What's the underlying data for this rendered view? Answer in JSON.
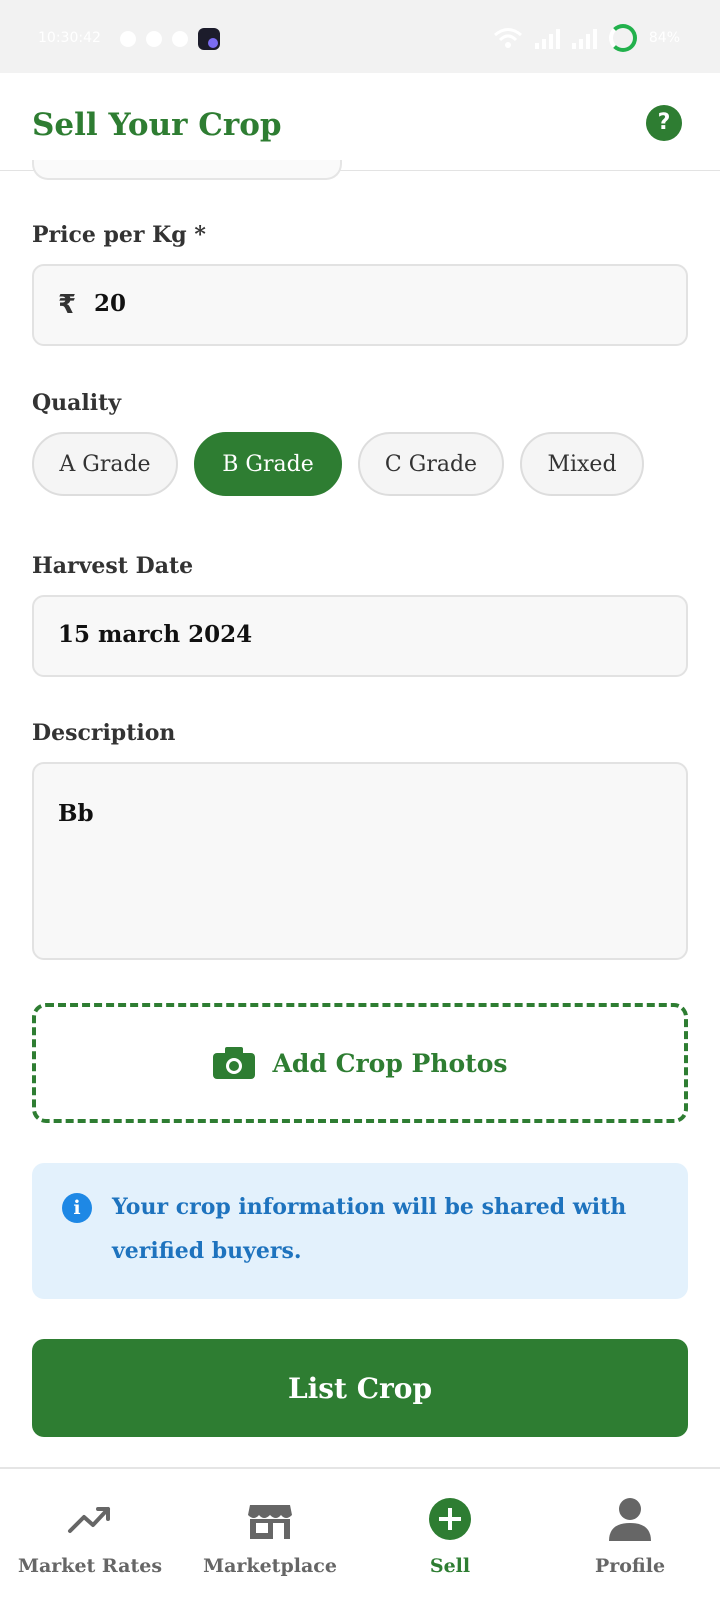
{
  "status_bar": {
    "time": "10:30:42",
    "battery": "84%"
  },
  "header": {
    "title": "Sell Your Crop",
    "help_icon": "question-circle-icon",
    "help_glyph": "?"
  },
  "form": {
    "price": {
      "label": "Price per Kg *",
      "currency_symbol": "₹",
      "value": "20"
    },
    "quality": {
      "label": "Quality",
      "options": [
        "A Grade",
        "B Grade",
        "C Grade",
        "Mixed"
      ],
      "selected": "B Grade"
    },
    "harvest_date": {
      "label": "Harvest Date",
      "value": "15 march 2024"
    },
    "description": {
      "label": "Description",
      "value": "Bb"
    },
    "photos": {
      "label": "Add Crop Photos",
      "icon": "camera-icon"
    },
    "info": {
      "icon": "info-icon",
      "glyph": "i",
      "text": "Your crop information will be shared with verified buyers."
    },
    "submit_label": "List Crop"
  },
  "bottom_nav": {
    "items": [
      {
        "label": "Market Rates",
        "icon": "trending-up-icon"
      },
      {
        "label": "Marketplace",
        "icon": "storefront-icon"
      },
      {
        "label": "Sell",
        "icon": "add-circle-icon",
        "active": true
      },
      {
        "label": "Profile",
        "icon": "person-icon"
      }
    ]
  },
  "colors": {
    "primary": "#2e7d32",
    "info_bg": "#e3f1fc",
    "info_text": "#1e73be",
    "info_icon": "#1e88e5"
  }
}
